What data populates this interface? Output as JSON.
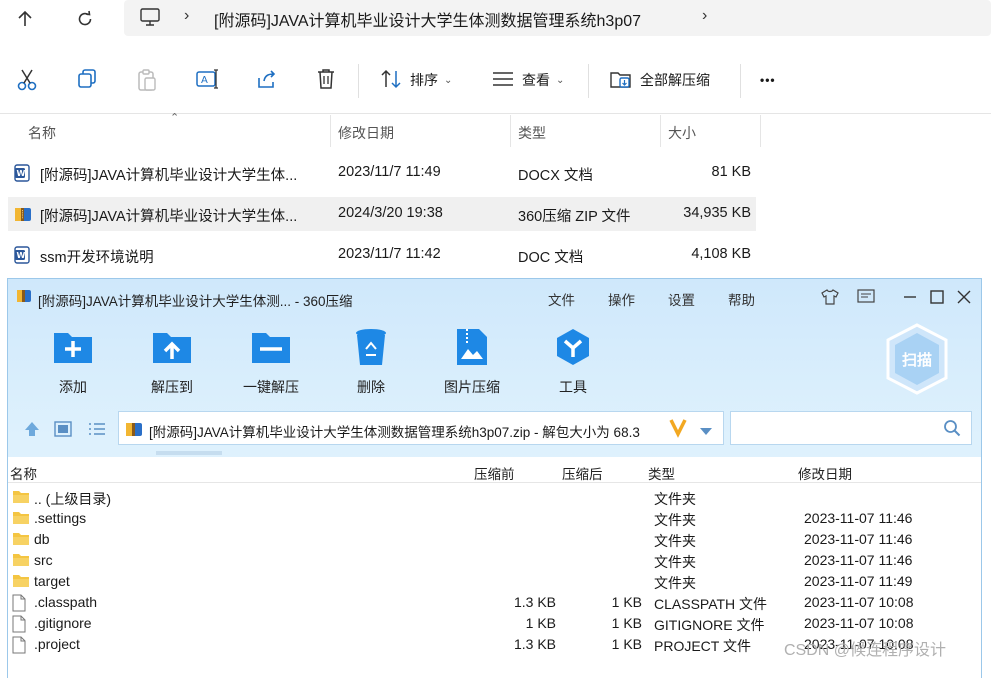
{
  "explorer": {
    "address": {
      "path": "[附源码]JAVA计算机毕业设计大学生体测数据管理系统h3p07"
    },
    "toolbar": {
      "sort_label": "排序",
      "view_label": "查看",
      "extract_all_label": "全部解压缩",
      "more_label": "•••"
    },
    "columns": {
      "name": "名称",
      "modified": "修改日期",
      "type": "类型",
      "size": "大小"
    },
    "files": [
      {
        "name": "[附源码]JAVA计算机毕业设计大学生体...",
        "modified": "2023/11/7 11:49",
        "type": "DOCX 文档",
        "size": "81 KB",
        "icon": "word-doc-icon"
      },
      {
        "name": "[附源码]JAVA计算机毕业设计大学生体...",
        "modified": "2024/3/20 19:38",
        "type": "360压缩 ZIP 文件",
        "size": "34,935 KB",
        "icon": "zip-archive-icon"
      },
      {
        "name": "ssm开发环境说明",
        "modified": "2023/11/7 11:42",
        "type": "DOC 文档",
        "size": "4,108 KB",
        "icon": "word-doc-icon"
      }
    ]
  },
  "zipwin": {
    "title": "[附源码]JAVA计算机毕业设计大学生体测... - 360压缩",
    "menu": [
      "文件",
      "操作",
      "设置",
      "帮助"
    ],
    "tools": [
      "添加",
      "解压到",
      "一键解压",
      "删除",
      "图片压缩",
      "工具"
    ],
    "scan_label": "扫描",
    "path_text": "[附源码]JAVA计算机毕业设计大学生体测数据管理系统h3p07.zip - 解包大小为 68.3",
    "columns": {
      "name": "名称",
      "before": "压缩前",
      "after": "压缩后",
      "type": "类型",
      "modified": "修改日期"
    },
    "rows": [
      {
        "name": ".. (上级目录)",
        "before": "",
        "after": "",
        "type": "文件夹",
        "modified": "",
        "icon": "folder-icon"
      },
      {
        "name": ".settings",
        "before": "",
        "after": "",
        "type": "文件夹",
        "modified": "2023-11-07 11:46",
        "icon": "folder-icon"
      },
      {
        "name": "db",
        "before": "",
        "after": "",
        "type": "文件夹",
        "modified": "2023-11-07 11:46",
        "icon": "folder-icon"
      },
      {
        "name": "src",
        "before": "",
        "after": "",
        "type": "文件夹",
        "modified": "2023-11-07 11:46",
        "icon": "folder-icon"
      },
      {
        "name": "target",
        "before": "",
        "after": "",
        "type": "文件夹",
        "modified": "2023-11-07 11:49",
        "icon": "folder-icon"
      },
      {
        "name": ".classpath",
        "before": "1.3 KB",
        "after": "1 KB",
        "type": "CLASSPATH 文件",
        "modified": "2023-11-07 10:08",
        "icon": "file-icon"
      },
      {
        "name": ".gitignore",
        "before": "1 KB",
        "after": "1 KB",
        "type": "GITIGNORE 文件",
        "modified": "2023-11-07 10:08",
        "icon": "file-icon"
      },
      {
        "name": ".project",
        "before": "1.3 KB",
        "after": "1 KB",
        "type": "PROJECT 文件",
        "modified": "2023-11-07 10:08",
        "icon": "file-icon"
      }
    ]
  },
  "watermark": "CSDN @候连程序设计",
  "colors": {
    "accent": "#1e88e5",
    "window_bg": "#dff0fd",
    "folder": "#f4c542"
  }
}
